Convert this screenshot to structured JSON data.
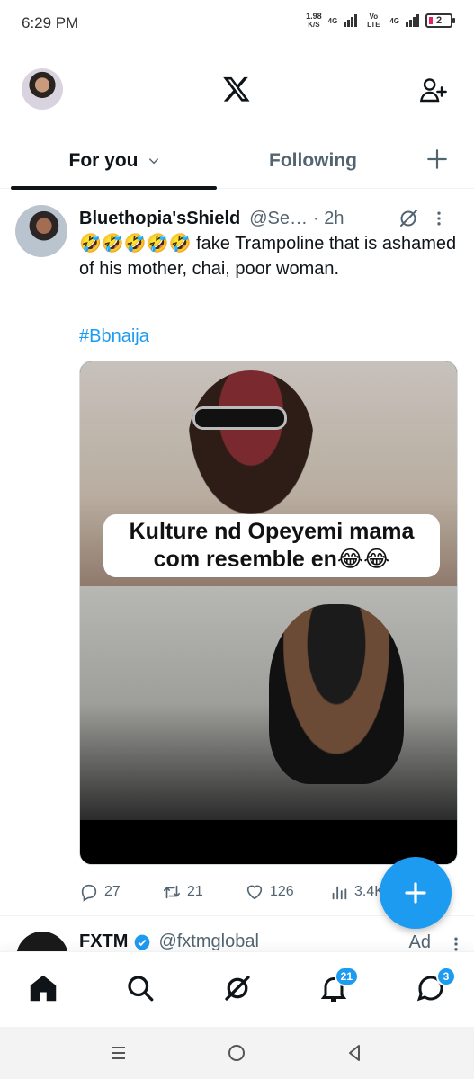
{
  "status_bar": {
    "time": "6:29 PM",
    "net_speed": "1.98",
    "net_unit": "K/S",
    "net_type_1": "4G",
    "volte": "Vo LTE",
    "net_type_2": "4G",
    "battery": "2"
  },
  "header": {
    "logo_icon": "x-logo-icon",
    "account_icon": "avatar",
    "add_account_icon": "add-user-icon"
  },
  "tabs": {
    "for_you": "For you",
    "following": "Following"
  },
  "tweet": {
    "author_name": "Bluethopia'sShield",
    "handle": "@Se…",
    "time": "· 2h",
    "text": "🤣🤣🤣🤣🤣 fake Trampoline that is ashamed of his mother, chai, poor woman.",
    "hashtag": "#Bbnaija",
    "media_caption": "Kulture nd Opeyemi mama com resemble en😂😂",
    "replies": "27",
    "retweets": "21",
    "likes": "126",
    "views": "3.4K"
  },
  "tweet2": {
    "author_name": "FXTM",
    "handle": "@fxtmglobal",
    "ad_label": "Ad"
  },
  "bottom_nav": {
    "notifications_badge": "21",
    "messages_badge": "3"
  },
  "colors": {
    "accent": "#1d9bf0",
    "text": "#0f1419",
    "secondary_text": "#536471"
  }
}
